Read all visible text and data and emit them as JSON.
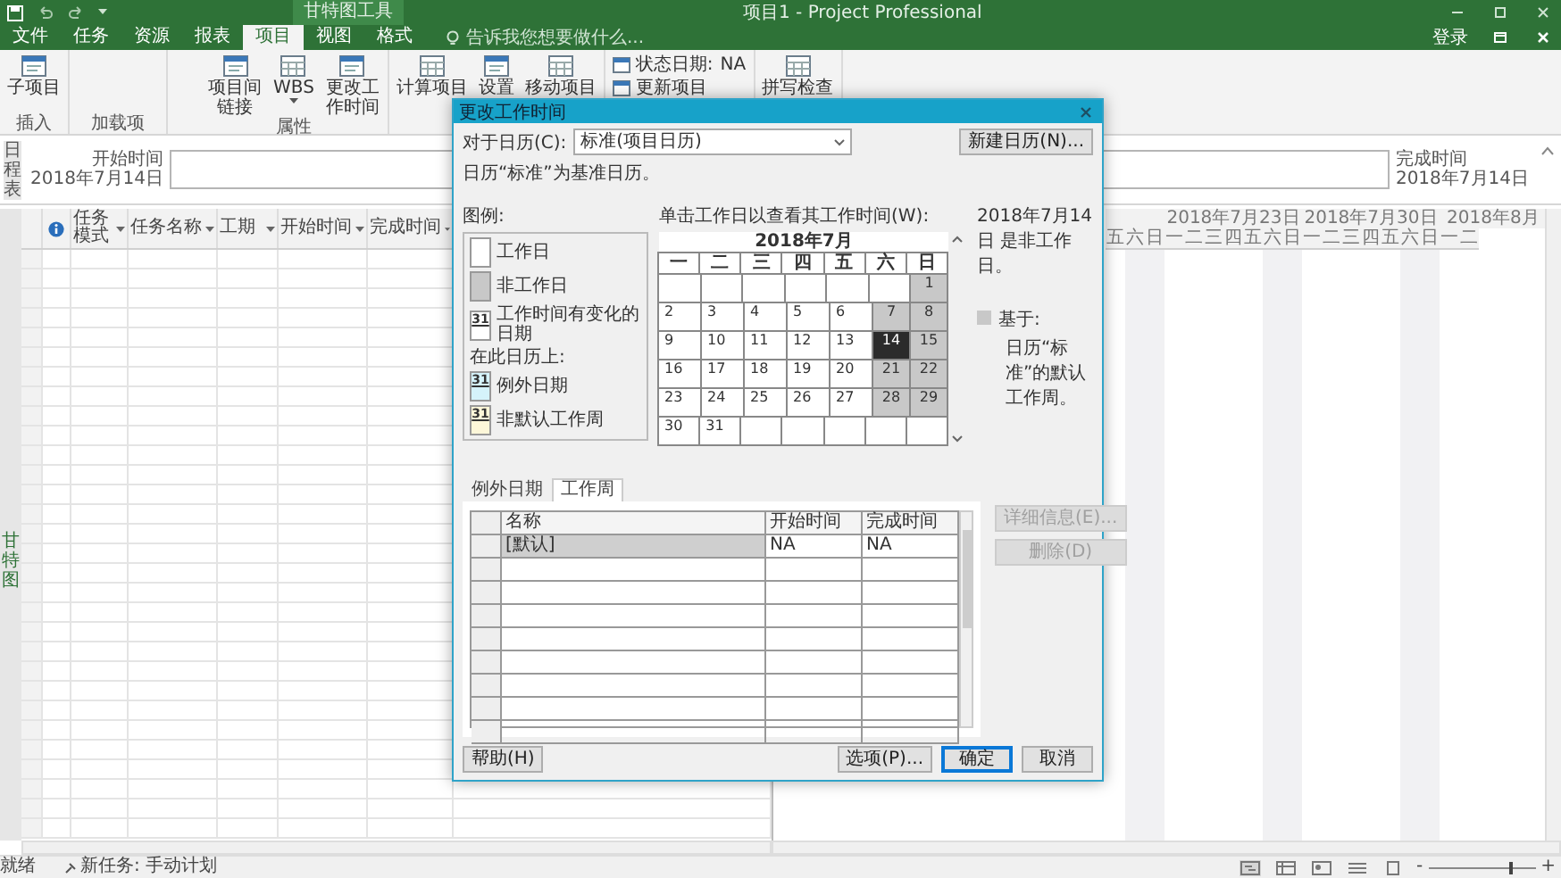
{
  "title_bar": {
    "context_tab": "甘特图工具",
    "title": "项目1 - Project Professional"
  },
  "tabs": [
    {
      "label": "文件",
      "selected": false
    },
    {
      "label": "任务",
      "selected": false
    },
    {
      "label": "资源",
      "selected": false
    },
    {
      "label": "报表",
      "selected": false
    },
    {
      "label": "项目",
      "selected": true
    },
    {
      "label": "视图",
      "selected": false
    },
    {
      "label": "格式",
      "selected": false
    }
  ],
  "tell_me": {
    "placeholder": "告诉我您想要做什么..."
  },
  "sign_in": "登录",
  "ribbon": [
    {
      "label": "插入",
      "commands": [
        {
          "label": "子项目",
          "kind": "large"
        }
      ]
    },
    {
      "label": "加载项"
    },
    {
      "label": "属性",
      "commands": [
        {
          "label": "项目间链接",
          "kind": "tall"
        },
        {
          "label": "WBS",
          "kind": "dropdown"
        },
        {
          "label": "更改工作时间",
          "kind": "tall"
        }
      ]
    },
    {
      "commands": [
        {
          "label": "计算项目",
          "kind": "large"
        },
        {
          "label": "设置",
          "kind": "large"
        },
        {
          "label": "移动项目",
          "kind": "large"
        }
      ]
    },
    {
      "commands": [
        {
          "label": "状态日期:",
          "value": "NA",
          "kind": "small"
        },
        {
          "label": "更新项目",
          "kind": "small"
        }
      ]
    },
    {
      "commands": [
        {
          "label": "拼写检查",
          "kind": "large"
        }
      ]
    }
  ],
  "timeline": {
    "side_label": "日程表",
    "start_label": "开始时间",
    "start_date": "2018年7月14日",
    "finish_label": "完成时间",
    "finish_date": "2018年7月14日"
  },
  "table": {
    "side_label": "甘特图",
    "columns": [
      {
        "label": "任务模式"
      },
      {
        "label": "任务名称"
      },
      {
        "label": "工期"
      },
      {
        "label": "开始时间"
      },
      {
        "label": "完成时间"
      }
    ]
  },
  "timescale": {
    "weeks": [
      {
        "label": "2018年7月23日"
      },
      {
        "label": "2018年7月30日"
      },
      {
        "label": "2018年8月"
      }
    ],
    "days": [
      {
        "label": "五",
        "nonworking": false
      },
      {
        "label": "六",
        "nonworking": true
      },
      {
        "label": "日",
        "nonworking": true
      },
      {
        "label": "一",
        "nonworking": false
      },
      {
        "label": "二",
        "nonworking": false
      },
      {
        "label": "三",
        "nonworking": false
      },
      {
        "label": "四",
        "nonworking": false
      },
      {
        "label": "五",
        "nonworking": false
      },
      {
        "label": "六",
        "nonworking": true
      },
      {
        "label": "日",
        "nonworking": true
      },
      {
        "label": "一",
        "nonworking": false
      },
      {
        "label": "二",
        "nonworking": false
      },
      {
        "label": "三",
        "nonworking": false
      },
      {
        "label": "四",
        "nonworking": false
      },
      {
        "label": "五",
        "nonworking": false
      },
      {
        "label": "六",
        "nonworking": true
      },
      {
        "label": "日",
        "nonworking": true
      },
      {
        "label": "一",
        "nonworking": false
      },
      {
        "label": "二",
        "nonworking": false
      }
    ]
  },
  "status_bar": {
    "ready": "就绪",
    "new_tasks": "新任务: 手动计划",
    "zoom_out": "-",
    "zoom_in": "+",
    "zoom": {
      "level": 0.75
    }
  },
  "dialog": {
    "title": "更改工作时间",
    "calendar_label": "对于日历(C):",
    "calendar_value": "标准(项目日历)",
    "new_calendar": "新建日历(N)...",
    "note": "日历“标准”为基准日历。",
    "legend": {
      "title": "图例:",
      "items": [
        {
          "kind": "working",
          "label": "工作日"
        },
        {
          "kind": "nonworking",
          "label": "非工作日"
        },
        {
          "kind": "changed",
          "label": "工作时间有变化的日期",
          "sample": "31"
        },
        {
          "kind": "heading",
          "label": "在此日历上:"
        },
        {
          "kind": "exception",
          "label": "例外日期",
          "sample": "31"
        },
        {
          "kind": "nondefault",
          "label": "非默认工作周",
          "sample": "31"
        }
      ]
    },
    "calendar": {
      "instruction": "单击工作日以查看其工作时间(W):",
      "month": "2018年7月",
      "weekdays": [
        "一",
        "二",
        "三",
        "四",
        "五",
        "六",
        "日"
      ],
      "weeks": [
        [
          {
            "kind": "blank",
            "selected": false
          },
          {
            "kind": "blank",
            "selected": false
          },
          {
            "kind": "blank",
            "selected": false
          },
          {
            "kind": "blank",
            "selected": false
          },
          {
            "kind": "blank",
            "selected": false
          },
          {
            "kind": "blank",
            "selected": false
          },
          {
            "day": "1",
            "kind": "nonworking",
            "selected": false
          }
        ],
        [
          {
            "day": "2",
            "kind": "working",
            "selected": false
          },
          {
            "day": "3",
            "kind": "working",
            "selected": false
          },
          {
            "day": "4",
            "kind": "working",
            "selected": false
          },
          {
            "day": "5",
            "kind": "working",
            "selected": false
          },
          {
            "day": "6",
            "kind": "working",
            "selected": false
          },
          {
            "day": "7",
            "kind": "nonworking",
            "selected": false
          },
          {
            "day": "8",
            "kind": "nonworking",
            "selected": false
          }
        ],
        [
          {
            "day": "9",
            "kind": "working",
            "selected": false
          },
          {
            "day": "10",
            "kind": "working",
            "selected": false
          },
          {
            "day": "11",
            "kind": "working",
            "selected": false
          },
          {
            "day": "12",
            "kind": "working",
            "selected": false
          },
          {
            "day": "13",
            "kind": "working",
            "selected": false
          },
          {
            "day": "14",
            "kind": "nonworking",
            "selected": true
          },
          {
            "day": "15",
            "kind": "nonworking",
            "selected": false
          }
        ],
        [
          {
            "day": "16",
            "kind": "working",
            "selected": false
          },
          {
            "day": "17",
            "kind": "working",
            "selected": false
          },
          {
            "day": "18",
            "kind": "working",
            "selected": false
          },
          {
            "day": "19",
            "kind": "working",
            "selected": false
          },
          {
            "day": "20",
            "kind": "working",
            "selected": false
          },
          {
            "day": "21",
            "kind": "nonworking",
            "selected": false
          },
          {
            "day": "22",
            "kind": "nonworking",
            "selected": false
          }
        ],
        [
          {
            "day": "23",
            "kind": "working",
            "selected": false
          },
          {
            "day": "24",
            "kind": "working",
            "selected": false
          },
          {
            "day": "25",
            "kind": "working",
            "selected": false
          },
          {
            "day": "26",
            "kind": "working",
            "selected": false
          },
          {
            "day": "27",
            "kind": "working",
            "selected": false
          },
          {
            "day": "28",
            "kind": "nonworking",
            "selected": false
          },
          {
            "day": "29",
            "kind": "nonworking",
            "selected": false
          }
        ],
        [
          {
            "day": "30",
            "kind": "working",
            "selected": false
          },
          {
            "day": "31",
            "kind": "working",
            "selected": false
          },
          {
            "kind": "blank",
            "selected": false
          },
          {
            "kind": "blank",
            "selected": false
          },
          {
            "kind": "blank",
            "selected": false
          },
          {
            "kind": "blank",
            "selected": false
          },
          {
            "kind": "blank",
            "selected": false
          }
        ]
      ]
    },
    "day_note": "2018年7月14日 是非工作日。",
    "based_on": "基于:",
    "based_on_detail": "日历“标准”的默认工作周。",
    "tabs": [
      {
        "label": "例外日期",
        "selected": false
      },
      {
        "label": "工作周",
        "selected": true
      }
    ],
    "grid": {
      "columns": [
        "名称",
        "开始时间",
        "完成时间"
      ],
      "rows": [
        {
          "cells": [
            "[默认]",
            "NA",
            "NA"
          ],
          "selected": true
        }
      ]
    },
    "side_buttons": [
      {
        "label": "详细信息(E)...",
        "disabled": true
      },
      {
        "label": "删除(D)",
        "disabled": true
      }
    ],
    "help": "帮助(H)",
    "buttons": [
      {
        "label": "选项(P)...",
        "default": false
      },
      {
        "label": "确定",
        "default": true
      },
      {
        "label": "取消",
        "default": false
      }
    ]
  }
}
